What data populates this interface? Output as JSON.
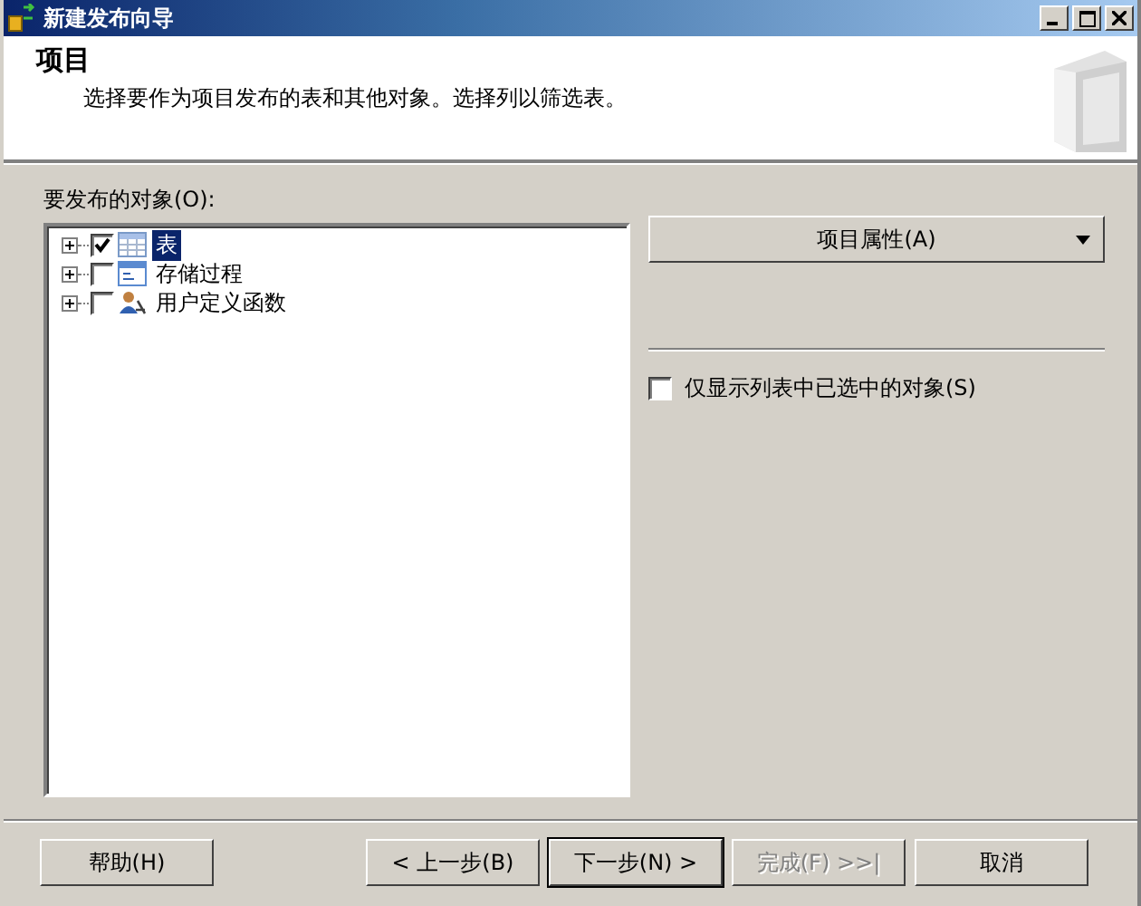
{
  "window": {
    "title": "新建发布向导"
  },
  "header": {
    "title": "项目",
    "description": "选择要作为项目发布的表和其他对象。选择列以筛选表。"
  },
  "objects": {
    "label": "要发布的对象(O):",
    "items": [
      {
        "label": "表",
        "kind": "table",
        "checked": true,
        "selected": true,
        "expanded": false
      },
      {
        "label": "存储过程",
        "kind": "procedure",
        "checked": false,
        "selected": false,
        "expanded": false
      },
      {
        "label": "用户定义函数",
        "kind": "function",
        "checked": false,
        "selected": false,
        "expanded": false
      }
    ]
  },
  "properties_button": {
    "label": "项目属性(A)"
  },
  "filter": {
    "label": "仅显示列表中已选中的对象(S)",
    "checked": false
  },
  "buttons": [
    {
      "label": "帮助(H)",
      "disabled": false,
      "default": false
    },
    {
      "label": "< 上一步(B)",
      "disabled": false,
      "default": false
    },
    {
      "label": "下一步(N) >",
      "disabled": false,
      "default": true
    },
    {
      "label": "完成(F) >>|",
      "disabled": true,
      "default": false
    },
    {
      "label": "取消",
      "disabled": false,
      "default": false
    }
  ]
}
